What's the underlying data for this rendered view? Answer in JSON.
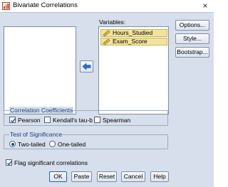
{
  "window": {
    "title": "Bivariate Correlations",
    "close_glyph": "×"
  },
  "variables": {
    "label": "Variables:",
    "items": [
      {
        "label": "Hours_Studied",
        "icon": "scale-variable-icon"
      },
      {
        "label": "Exam_Score",
        "icon": "scale-variable-icon"
      }
    ]
  },
  "side_buttons": {
    "options": "Options...",
    "style": "Style...",
    "bootstrap": "Bootstrap..."
  },
  "correlation_coefficients": {
    "title": "Correlation Coefficients",
    "pearson": {
      "label": "Pearson",
      "checked": true
    },
    "kendall": {
      "label": "Kendall's tau-b",
      "checked": false
    },
    "spearman": {
      "label": "Spearman",
      "checked": false
    }
  },
  "test_of_significance": {
    "title": "Test of Significance",
    "two_tailed": {
      "label": "Two-tailed",
      "selected": true
    },
    "one_tailed": {
      "label": "One-tailed",
      "selected": false
    }
  },
  "flag": {
    "label": "Flag significant correlations",
    "checked": true
  },
  "buttons": {
    "ok": "OK",
    "paste": "Paste",
    "reset": "Reset",
    "cancel": "Cancel",
    "help": "Help"
  },
  "colors": {
    "dialog_bg": "#d6dfeb",
    "selected_item": "#f2e39a",
    "group_title": "#1a3c78",
    "arrow_blue": "#2f6fc4"
  }
}
